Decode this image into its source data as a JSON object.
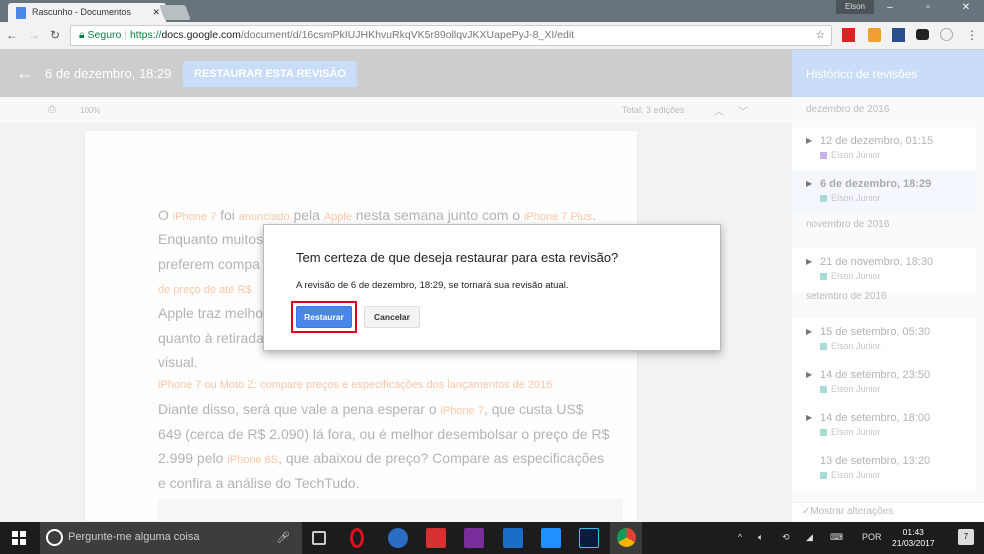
{
  "browser": {
    "tab_title": "Rascunho - Documentos",
    "user": "Elson",
    "secure_label": "Seguro",
    "url_scheme": "https://",
    "url_host": "docs.google.com",
    "url_path": "/document/d/16csmPkIUJHKhvuRkqVK5r89ollqvJKXUapePyJ-8_XI/edit"
  },
  "header": {
    "revision_date": "6 de dezembro, 18:29",
    "restore_button": "RESTAURAR ESTA REVISÃO",
    "panel_title": "Histórico de revisões"
  },
  "toolbar": {
    "zoom": "100%",
    "total": "Total: 3 edições"
  },
  "document": {
    "l1": [
      "O ",
      "iPhone 7",
      " foi ",
      "anunciado",
      " pela ",
      "Apple",
      " nesta semana junto com o ",
      "iPhone 7 Plus",
      "."
    ],
    "l2": "Enquanto muitos",
    "l3": "preferem compa",
    "l4": "de preço de até R$",
    "l5": "Apple traz melho",
    "l6": "quanto à retirada",
    "l7": "visual.",
    "l8": "iPhone 7 ou Moto Z: compare preços e especificações dos lançamentos de 2016",
    "l9": [
      "Diante disso, será que vale a pena esperar o ",
      "iPhone 7",
      ", que custa US$"
    ],
    "l10": "649 (cerca de R$ 2.090) lá fora, ou é melhor desembolsar o preço de R$",
    "l11": [
      "2.999 pelo ",
      "iPhone 6S",
      ", que abaixou de preço? Compare as especificações"
    ],
    "l12": "e confira a análise do TechTudo."
  },
  "dialog": {
    "title": "Tem certeza de que deseja restaurar para esta revisão?",
    "message": "A revisão de 6 de dezembro, 18:29, se tornará sua revisão atual.",
    "confirm": "Restaurar",
    "cancel": "Cancelar"
  },
  "history": {
    "months": [
      "dezembro de 2016",
      "novembro de 2016",
      "setembro de 2016"
    ],
    "entries": [
      {
        "title": "12 de dezembro, 01:15",
        "author": "Elson Júnior",
        "color": "#c5b5e6"
      },
      {
        "title": "6 de dezembro, 18:29",
        "author": "Elson Junior",
        "color": "#a6dcd4"
      },
      {
        "title": "21 de novembro, 18:30",
        "author": "Elson Junior",
        "color": "#a6dcd4"
      },
      {
        "title": "15 de setembro, 05:30",
        "author": "Elson Junior",
        "color": "#a6dcd4"
      },
      {
        "title": "14 de setembro, 23:50",
        "author": "Elson Junior",
        "color": "#a6dcd4"
      },
      {
        "title": "14 de setembro, 18:00",
        "author": "Elson Junior",
        "color": "#a6dcd4"
      },
      {
        "title": "13 de setembro, 13:20",
        "author": "Elson Junior",
        "color": "#a6dcd4"
      }
    ],
    "show_changes": "Mostrar alterações"
  },
  "taskbar": {
    "search_placeholder": "Pergunte-me alguma coisa",
    "lang": "POR",
    "time": "01:43",
    "date": "21/03/2017",
    "notifications": "7"
  }
}
